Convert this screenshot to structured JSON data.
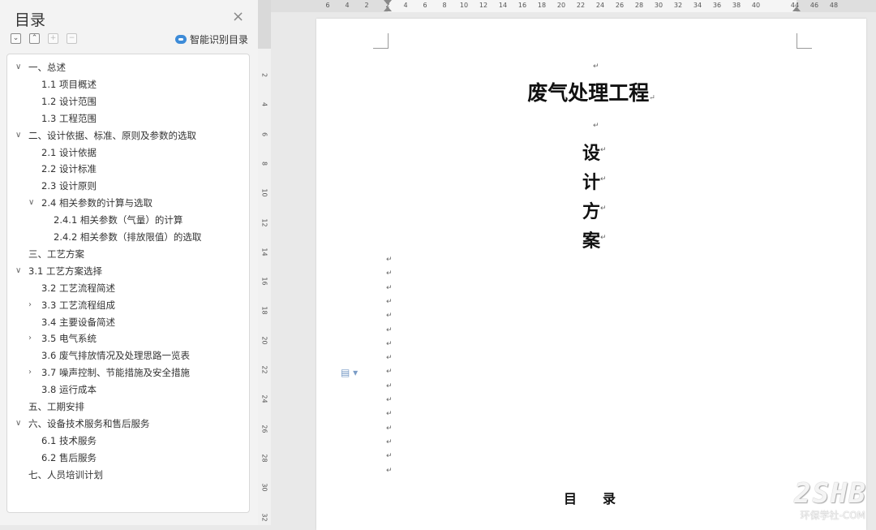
{
  "toc_panel": {
    "title": "目录",
    "close_glyph": "×",
    "toolbar": {
      "collapse_glyph": "⌄",
      "expand_glyph": "⌃",
      "add_glyph": "+",
      "remove_glyph": "−",
      "smart_label": "智能识别目录"
    },
    "items": [
      {
        "label": "一、总述",
        "level": 0,
        "arrow": "expanded"
      },
      {
        "label": "1.1 项目概述",
        "level": 1,
        "arrow": "none"
      },
      {
        "label": "1.2 设计范围",
        "level": 1,
        "arrow": "none"
      },
      {
        "label": "1.3 工程范围",
        "level": 1,
        "arrow": "none"
      },
      {
        "label": "二、设计依据、标准、原则及参数的选取",
        "level": 0,
        "arrow": "expanded"
      },
      {
        "label": "2.1 设计依据",
        "level": 1,
        "arrow": "none"
      },
      {
        "label": "2.2 设计标准",
        "level": 1,
        "arrow": "none"
      },
      {
        "label": "2.3 设计原则",
        "level": 1,
        "arrow": "none"
      },
      {
        "label": "2.4 相关参数的计算与选取",
        "level": 1,
        "arrow": "expanded"
      },
      {
        "label": "2.4.1 相关参数（气量）的计算",
        "level": 2,
        "arrow": "none"
      },
      {
        "label": "2.4.2 相关参数（排放限值）的选取",
        "level": 2,
        "arrow": "none"
      },
      {
        "label": "三、工艺方案",
        "level": 0,
        "arrow": "none"
      },
      {
        "label": "3.1 工艺方案选择",
        "level": 0,
        "arrow": "expanded"
      },
      {
        "label": "3.2 工艺流程简述",
        "level": 1,
        "arrow": "none"
      },
      {
        "label": "3.3 工艺流程组成",
        "level": 1,
        "arrow": "collapsed"
      },
      {
        "label": "3.4 主要设备简述",
        "level": 1,
        "arrow": "none"
      },
      {
        "label": "3.5 电气系统",
        "level": 1,
        "arrow": "collapsed"
      },
      {
        "label": "3.6 废气排放情况及处理思路一览表",
        "level": 1,
        "arrow": "none"
      },
      {
        "label": "3.7 噪声控制、节能措施及安全措施",
        "level": 1,
        "arrow": "collapsed"
      },
      {
        "label": "3.8 运行成本",
        "level": 1,
        "arrow": "none"
      },
      {
        "label": "五、工期安排",
        "level": 0,
        "arrow": "none"
      },
      {
        "label": "六、设备技术服务和售后服务",
        "level": 0,
        "arrow": "expanded"
      },
      {
        "label": "6.1 技术服务",
        "level": 1,
        "arrow": "none"
      },
      {
        "label": "6.2 售后服务",
        "level": 1,
        "arrow": "none"
      },
      {
        "label": "七、人员培训计划",
        "level": 0,
        "arrow": "none"
      }
    ]
  },
  "rulers": {
    "horizontal": [
      "6",
      "4",
      "2",
      "2",
      "4",
      "6",
      "8",
      "10",
      "12",
      "14",
      "16",
      "18",
      "20",
      "22",
      "24",
      "26",
      "28",
      "30",
      "32",
      "34",
      "36",
      "38",
      "40",
      "44",
      "46",
      "48"
    ],
    "vertical": [
      "2",
      "4",
      "6",
      "8",
      "10",
      "12",
      "14",
      "16",
      "18",
      "20",
      "22",
      "24",
      "26",
      "28",
      "30",
      "32"
    ]
  },
  "document": {
    "paragraph_mark": "↵",
    "title": "废气处理工程",
    "subtitle_chars": [
      "设",
      "计",
      "方",
      "案"
    ],
    "toc_heading": "目　　录"
  },
  "watermark": {
    "main": "2SHB",
    "sub": "环保学社-COM"
  }
}
